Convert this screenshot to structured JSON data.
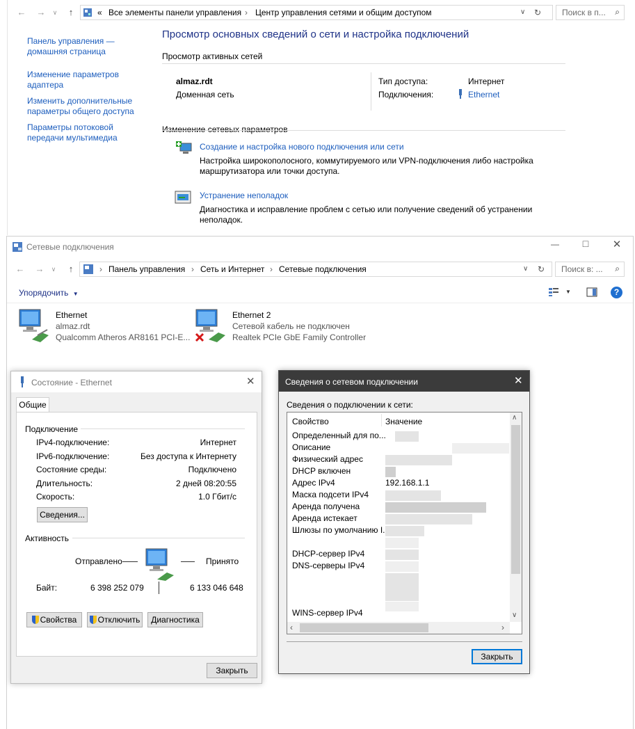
{
  "top_window": {
    "breadcrumb": [
      "«",
      "Все элементы панели управления",
      "Центр управления сетями и общим доступом"
    ],
    "search_placeholder": "Поиск в п...",
    "sidebar": [
      {
        "label": "Панель управления — домашняя страница"
      },
      {
        "label": "Изменение параметров адаптера"
      },
      {
        "label": "Изменить дополнительные параметры общего доступа"
      },
      {
        "label": "Параметры потоковой передачи мультимедиа"
      }
    ],
    "title": "Просмотр основных сведений о сети и настройка подключений",
    "active_networks_header": "Просмотр активных сетей",
    "network_name": "almaz.rdt",
    "network_type": "Доменная сеть",
    "access_type_label": "Тип доступа:",
    "access_type_value": "Интернет",
    "connections_label": "Подключения:",
    "connections_value": "Ethernet",
    "change_settings_header": "Изменение сетевых параметров",
    "actions": [
      {
        "title": "Создание и настройка нового подключения или сети",
        "desc": "Настройка широкополосного, коммутируемого или VPN-подключения либо настройка маршрутизатора или точки доступа."
      },
      {
        "title": "Устранение неполадок",
        "desc": "Диагностика и исправление проблем с сетью или получение сведений об устранении неполадок."
      }
    ]
  },
  "net_connections_window": {
    "title": "Сетевые подключения",
    "breadcrumb": [
      "Панель управления",
      "Сеть и Интернет",
      "Сетевые подключения"
    ],
    "search_placeholder": "Поиск в: ...",
    "organize_label": "Упорядочить",
    "adapters": [
      {
        "name": "Ethernet",
        "status": "almaz.rdt",
        "device": "Qualcomm Atheros AR8161 PCI-E..."
      },
      {
        "name": "Ethernet 2",
        "status": "Сетевой кабель не подключен",
        "device": "Realtek PCIe GbE Family Controller"
      }
    ]
  },
  "status_dialog": {
    "title": "Состояние - Ethernet",
    "tab": "Общие",
    "connection_group": "Подключение",
    "rows": [
      {
        "label": "IPv4-подключение:",
        "value": "Интернет"
      },
      {
        "label": "IPv6-подключение:",
        "value": "Без доступа к Интернету"
      },
      {
        "label": "Состояние среды:",
        "value": "Подключено"
      },
      {
        "label": "Длительность:",
        "value": "2 дней 08:20:55"
      },
      {
        "label": "Скорость:",
        "value": "1.0 Гбит/с"
      }
    ],
    "details_button": "Сведения...",
    "activity_group": "Активность",
    "sent_label": "Отправлено",
    "received_label": "Принято",
    "bytes_label": "Байт:",
    "bytes_sent": "6 398 252 079",
    "bytes_received": "6 133 046 648",
    "properties_button": "Свойства",
    "disable_button": "Отключить",
    "diagnose_button": "Диагностика",
    "close_button": "Закрыть"
  },
  "details_dialog": {
    "title": "Сведения о сетевом подключении",
    "subtitle": "Сведения о подключении к сети:",
    "col_property": "Свойство",
    "col_value": "Значение",
    "rows": [
      {
        "property": "Определенный для по...",
        "value": ""
      },
      {
        "property": "Описание",
        "value": ""
      },
      {
        "property": "Физический адрес",
        "value": ""
      },
      {
        "property": "DHCP включен",
        "value": ""
      },
      {
        "property": "Адрес IPv4",
        "value": "192.168.1.1"
      },
      {
        "property": "Маска подсети IPv4",
        "value": ""
      },
      {
        "property": "Аренда получена",
        "value": ""
      },
      {
        "property": "Аренда истекает",
        "value": ""
      },
      {
        "property": "Шлюзы по умолчанию I...",
        "value": ""
      },
      {
        "property": "",
        "value": ""
      },
      {
        "property": "DHCP-сервер IPv4",
        "value": ""
      },
      {
        "property": "DNS-серверы IPv4",
        "value": ""
      },
      {
        "property": "",
        "value": ""
      },
      {
        "property": "",
        "value": ""
      },
      {
        "property": "",
        "value": ""
      },
      {
        "property": "WINS-сервер IPv4",
        "value": ""
      }
    ],
    "close_button": "Закрыть"
  }
}
